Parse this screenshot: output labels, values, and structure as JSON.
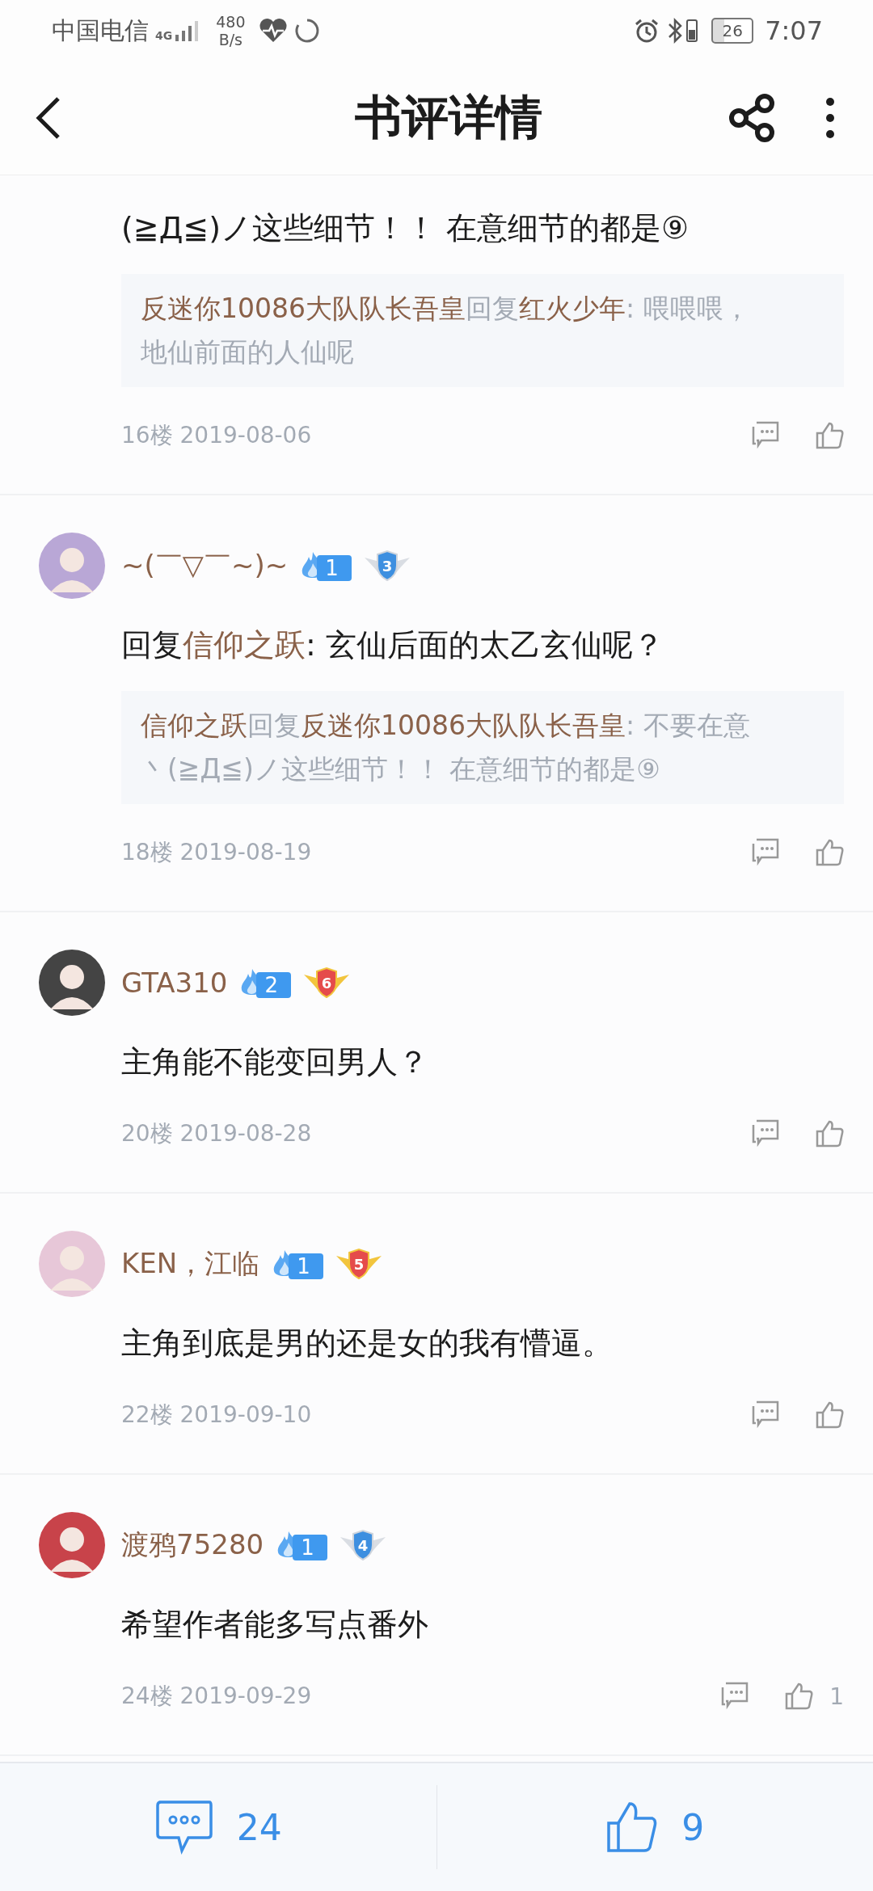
{
  "status_bar": {
    "carrier": "中国电信",
    "network": "4G",
    "speed_value": "480",
    "speed_unit": "B/s",
    "battery": "26",
    "time": "7:07"
  },
  "header": {
    "title": "书评详情"
  },
  "comments": [
    {
      "body": {
        "text": "(≧Д≦)ノ这些细节！！ 在意细节的都是⑨"
      },
      "quote": {
        "author": "反迷你10086大队队长吾皇",
        "verb": "回复",
        "target": "红火少年",
        "text": ": 喂喂喂，地仙前面的人仙呢"
      },
      "meta": "16楼 2019-08-06"
    },
    {
      "name": "~(￣▽￣~)~",
      "fire": "1",
      "rank": {
        "label": "3",
        "kind": "silver"
      },
      "body": {
        "prefix": "回复",
        "target": "信仰之跃",
        "text": ": 玄仙后面的太乙玄仙呢？"
      },
      "quote": {
        "author": "信仰之跃",
        "verb": "回复",
        "target": "反迷你10086大队队长吾皇",
        "text": ": 不要在意丶(≧Д≦)ノ这些细节！！ 在意细节的都是⑨"
      },
      "meta": "18楼 2019-08-19"
    },
    {
      "name": "GTA310",
      "fire": "2",
      "rank": {
        "label": "6",
        "kind": "gold"
      },
      "body": {
        "text": "主角能不能变回男人？"
      },
      "meta": "20楼 2019-08-28"
    },
    {
      "name": "KEN，江临",
      "fire": "1",
      "rank": {
        "label": "5",
        "kind": "gold"
      },
      "body": {
        "text": "主角到底是男的还是女的我有懵逼。"
      },
      "meta": "22楼 2019-09-10"
    },
    {
      "name": "渡鸦75280",
      "fire": "1",
      "rank": {
        "label": "4",
        "kind": "silver"
      },
      "body": {
        "text": "希望作者能多写点番外"
      },
      "meta": "24楼 2019-09-29",
      "likes": "1"
    }
  ],
  "bottom_bar": {
    "comments": "24",
    "likes": "9"
  }
}
